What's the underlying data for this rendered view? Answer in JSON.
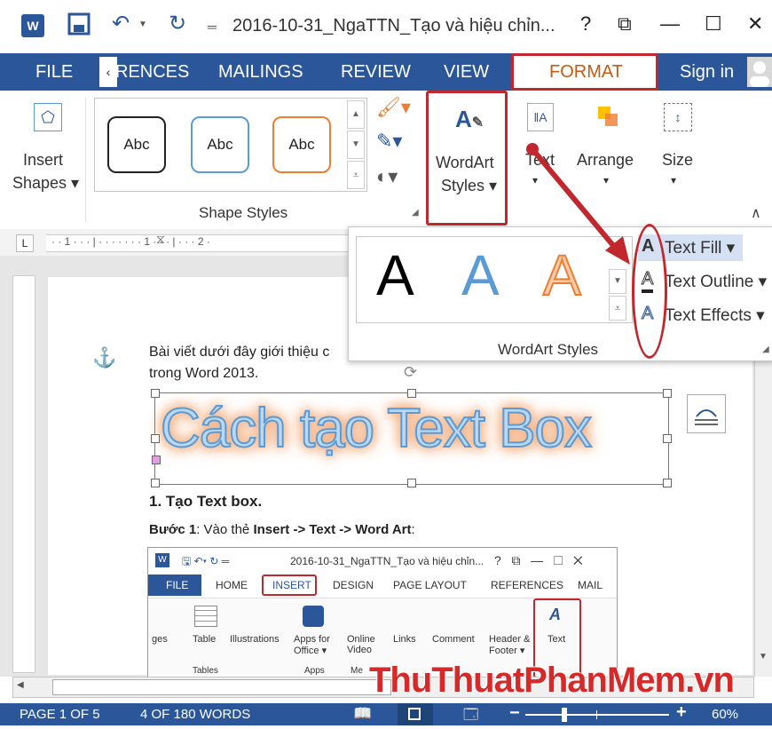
{
  "window": {
    "title": "2016-10-31_NgaTTN_Tạo và hiệu chỉn...",
    "help": "?",
    "restore": "⧉",
    "minimize": "—",
    "maximize": "☐",
    "close": "✕"
  },
  "tabs": {
    "file": "FILE",
    "references": "RENCES",
    "mailings": "MAILINGS",
    "review": "REVIEW",
    "view": "VIEW",
    "format": "FORMAT",
    "sign_in": "Sign in"
  },
  "ribbon": {
    "insert_shapes": [
      "Insert",
      "Shapes ▾"
    ],
    "shape_styles": [
      "Abc",
      "Abc",
      "Abc"
    ],
    "shape_styles_label": "Shape Styles",
    "wordart_styles": [
      "WordArt",
      "Styles ▾"
    ],
    "text": [
      "Text",
      "▾"
    ],
    "arrange": [
      "Arrange",
      "▾"
    ],
    "size": [
      "Size",
      "▾"
    ]
  },
  "ruler": {
    "marks": "· · 1 · · · | · · · · · · · 1 · · · | · · · 2 ·"
  },
  "wordart_panel": {
    "letters": [
      "A",
      "A",
      "A"
    ],
    "label": "WordArt Styles",
    "menu": [
      "Text Fill ▾",
      "Text Outline ▾",
      "Text Effects ▾"
    ]
  },
  "document": {
    "para1_line1": "Bài viết dưới đây giới thiệu c",
    "para1_line2": "trong Word 2013.",
    "wordart": "Cách tạo Text Box",
    "heading": "1. Tạo Text box.",
    "step_bold": "Bước 1",
    "step_rest": ": Vào thẻ ",
    "step_path": "Insert -> Text -> Word Art",
    "step_end": ":"
  },
  "inner_screenshot": {
    "title": "2016-10-31_NgaTTN_Tạo và hiệu chỉn...",
    "tabs": [
      "FILE",
      "HOME",
      "INSERT",
      "DESIGN",
      "PAGE LAYOUT",
      "REFERENCES",
      "MAIL"
    ],
    "buttons": [
      "ges",
      "Table",
      "Illustrations",
      "Apps for Office ▾",
      "Online Video",
      "Links",
      "Comment",
      "Header & Footer ▾",
      "Text"
    ],
    "groups": [
      "Tables",
      "Apps",
      "Me"
    ]
  },
  "watermark": "ThuThuatPhanMem.vn",
  "status": {
    "page": "PAGE 1 OF 5",
    "words": "4 OF 180 WORDS",
    "zoom": "60%",
    "zoom_level": 0.6
  },
  "colors": {
    "ribbon_blue": "#2b579a",
    "highlight_red": "#c0282d",
    "format_orange": "#c55a11"
  }
}
